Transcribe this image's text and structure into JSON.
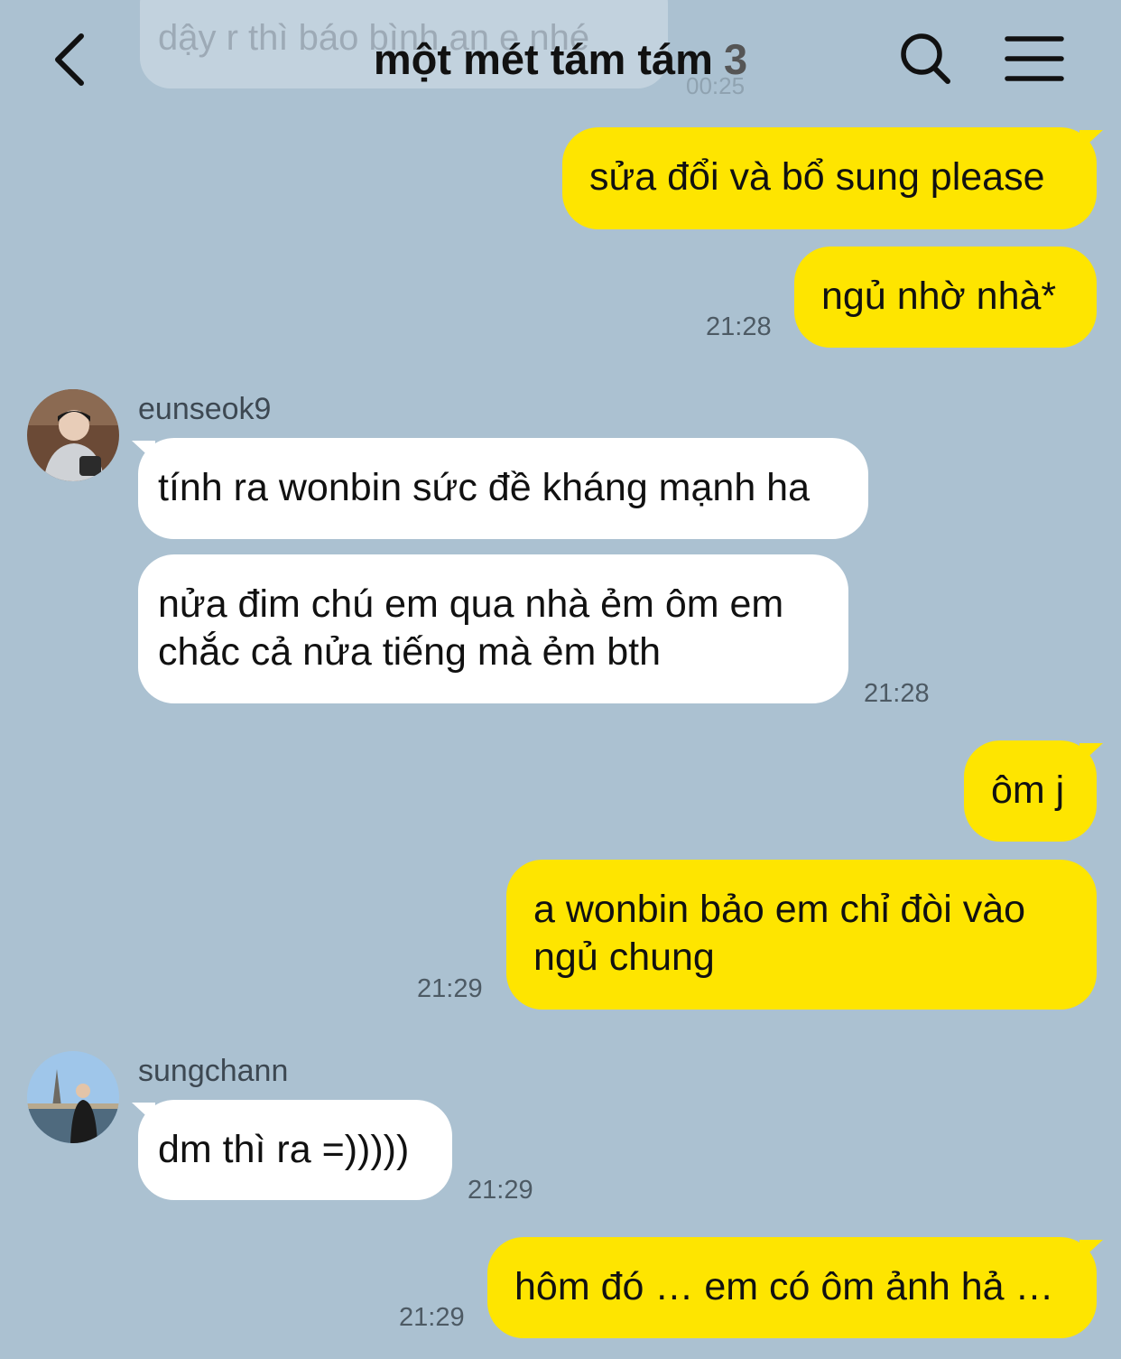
{
  "header": {
    "title": "một mét tám tám",
    "member_count": "3",
    "back_icon": "chevron-left-icon",
    "search_icon": "search-icon",
    "menu_icon": "hamburger-menu-icon"
  },
  "ghost_message": {
    "text": "dậy r thì báo bình an e nhé",
    "time": "00:25"
  },
  "messages": [
    {
      "direction": "out",
      "text": "sửa đổi và bổ sung please"
    },
    {
      "direction": "out",
      "text": "ngủ nhờ nhà*",
      "time": "21:28"
    },
    {
      "direction": "in",
      "sender": "eunseok9",
      "text": "tính ra wonbin sức đề kháng mạnh ha"
    },
    {
      "direction": "in",
      "text_lines": [
        "nửa đim chú em qua nhà ẻm ôm em",
        "chắc cả nửa tiếng mà ẻm bth"
      ],
      "time": "21:28"
    },
    {
      "direction": "out",
      "text": "ôm j"
    },
    {
      "direction": "out",
      "text_lines": [
        "a wonbin bảo em chỉ đòi vào",
        "ngủ chung"
      ],
      "time": "21:29"
    },
    {
      "direction": "in",
      "sender": "sungchann",
      "text": "dm thì ra =)))))",
      "time": "21:29"
    },
    {
      "direction": "out",
      "text": "hôm đó … em có ôm ảnh hả …",
      "time": "21:29"
    }
  ],
  "colors": {
    "background": "#abc1d1",
    "outgoing_bubble": "#fee500",
    "incoming_bubble": "#ffffff"
  }
}
